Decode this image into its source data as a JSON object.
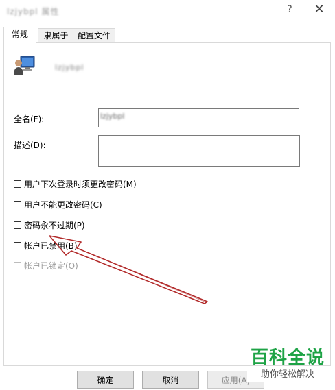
{
  "window": {
    "title": "lzjybpl 属性",
    "help_symbol": "?",
    "close_symbol": "✕"
  },
  "tabs": [
    {
      "label": "常规",
      "active": true
    },
    {
      "label": "隶属于",
      "active": false
    },
    {
      "label": "配置文件",
      "active": false
    }
  ],
  "general": {
    "user_icon": "user-computer-icon",
    "username": "lzjybpl",
    "fullname_label": "全名(F):",
    "fullname_value": "lzjybpl",
    "description_label": "描述(D):",
    "description_value": ""
  },
  "options": [
    {
      "label": "用户下次登录时须更改密码(M)",
      "checked": false,
      "enabled": true
    },
    {
      "label": "用户不能更改密码(C)",
      "checked": false,
      "enabled": true
    },
    {
      "label": "密码永不过期(P)",
      "checked": false,
      "enabled": true
    },
    {
      "label": "帐户已禁用(B)",
      "checked": false,
      "enabled": true
    },
    {
      "label": "帐户已锁定(O)",
      "checked": false,
      "enabled": false
    }
  ],
  "buttons": {
    "ok": "确定",
    "cancel": "取消",
    "apply": "应用(A)"
  },
  "watermark": {
    "main": "百科全说",
    "sub": "助你轻松解决"
  },
  "colors": {
    "annotation_arrow": "#b22a2a",
    "watermark_green": "#1ea346"
  }
}
